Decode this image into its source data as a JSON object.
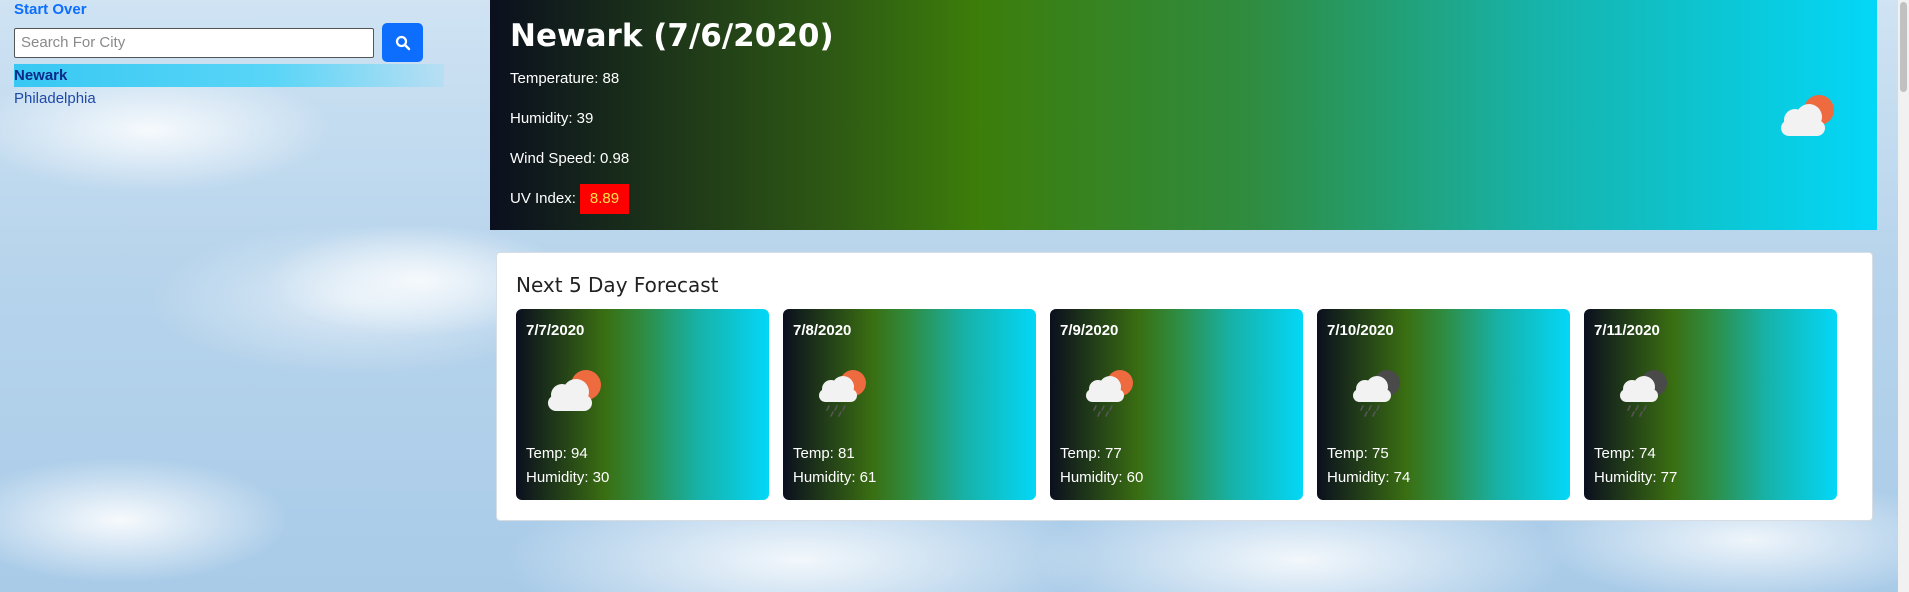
{
  "sidebar": {
    "start_over": "Start Over",
    "search_placeholder": "Search For City",
    "search_icon": "search-icon",
    "cities": [
      "Newark",
      "Philadelphia"
    ],
    "active_city": "Newark"
  },
  "current": {
    "title": "Newark (7/6/2020)",
    "temperature": "Temperature: 88",
    "humidity": "Humidity: 39",
    "wind": "Wind Speed: 0.98",
    "uv_label": "UV Index:",
    "uv_value": "8.89",
    "uv_color": "#ff0000",
    "icon": "partly-cloudy-sun-icon"
  },
  "forecast": {
    "heading": "Next 5 Day Forecast",
    "days": [
      {
        "date": "7/7/2020",
        "temp": "Temp: 94",
        "humidity": "Humidity: 30",
        "icon": "cloud-sun-icon"
      },
      {
        "date": "7/8/2020",
        "temp": "Temp: 81",
        "humidity": "Humidity: 61",
        "icon": "cloud-sun-rain-icon"
      },
      {
        "date": "7/9/2020",
        "temp": "Temp: 77",
        "humidity": "Humidity: 60",
        "icon": "cloud-sun-rain-icon"
      },
      {
        "date": "7/10/2020",
        "temp": "Temp: 75",
        "humidity": "Humidity: 74",
        "icon": "cloud-rain-night-icon"
      },
      {
        "date": "7/11/2020",
        "temp": "Temp: 74",
        "humidity": "Humidity: 77",
        "icon": "cloud-rain-night-icon"
      }
    ]
  },
  "colors": {
    "accent": "#0d6efd",
    "active_city_bg": "#37c8f3",
    "gradient_start": "#0b0f1e",
    "gradient_mid": "#3c7d0a",
    "gradient_end": "#03d7f8"
  }
}
